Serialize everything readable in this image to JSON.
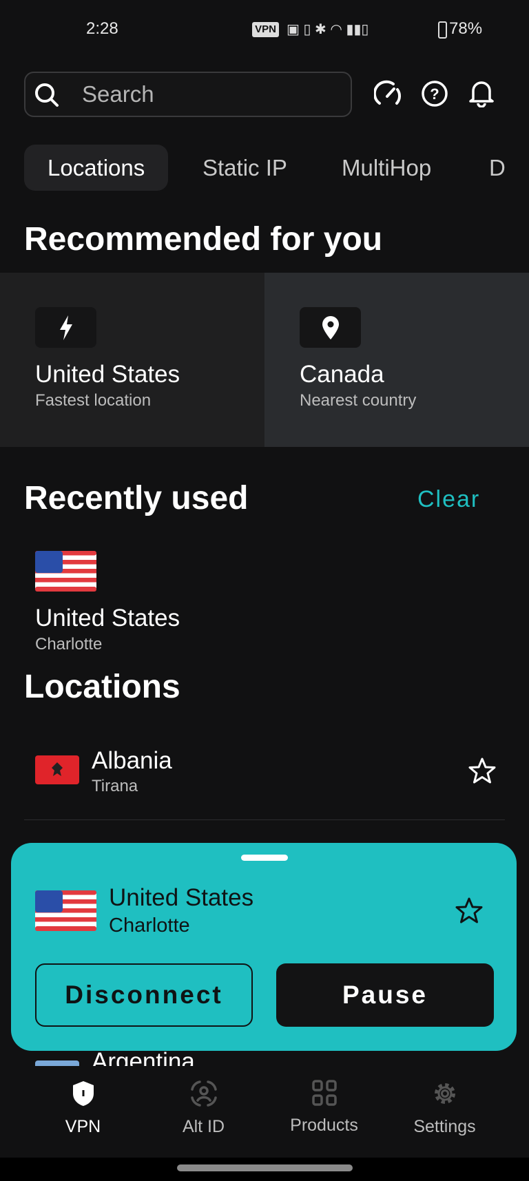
{
  "status_bar": {
    "time": "2:28",
    "vpn_badge": "VPN",
    "battery": "78%"
  },
  "header": {
    "search_placeholder": "Search",
    "icons": [
      "speedometer-icon",
      "help-icon",
      "bell-icon"
    ]
  },
  "tabs": [
    {
      "label": "Locations",
      "active": true
    },
    {
      "label": "Static IP"
    },
    {
      "label": "MultiHop"
    },
    {
      "label": "D"
    }
  ],
  "recommended": {
    "heading": "Recommended for you",
    "cards": [
      {
        "title": "United States",
        "subtitle": "Fastest location",
        "icon": "bolt-icon"
      },
      {
        "title": "Canada",
        "subtitle": "Nearest country",
        "icon": "location-pin-icon"
      }
    ]
  },
  "recent": {
    "heading": "Recently used",
    "clear_label": "Clear",
    "items": [
      {
        "country": "United States",
        "city": "Charlotte"
      }
    ]
  },
  "locations": {
    "heading": "Locations",
    "items": [
      {
        "country": "Albania",
        "city": "Tirana"
      },
      {
        "country": "Argentina"
      }
    ]
  },
  "connection_sheet": {
    "country": "United States",
    "city": "Charlotte",
    "disconnect_label": "Disconnect",
    "pause_label": "Pause"
  },
  "bottom_nav": [
    {
      "label": "VPN",
      "active": true
    },
    {
      "label": "Alt ID"
    },
    {
      "label": "Products"
    },
    {
      "label": "Settings"
    }
  ],
  "colors": {
    "accent": "#1fbfc1",
    "background": "#111112"
  }
}
